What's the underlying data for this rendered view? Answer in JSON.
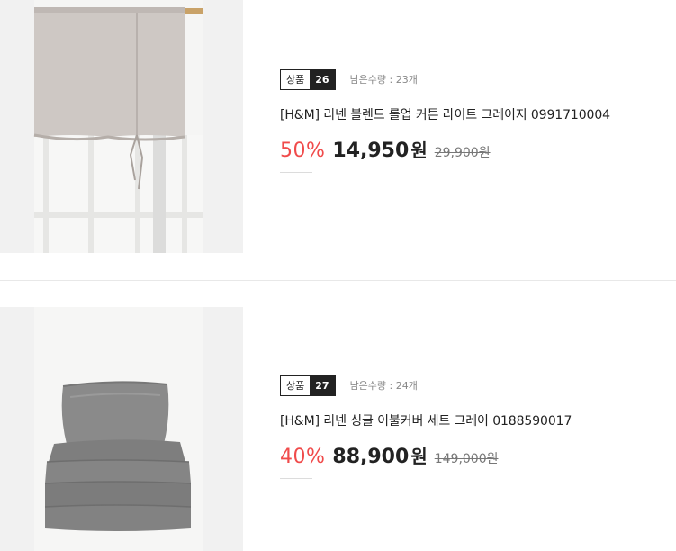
{
  "products": [
    {
      "badge_label": "상품",
      "badge_number": "26",
      "stock_text": "남은수량 : 23개",
      "title": "[H&M] 리넨 블렌드 롤업 커튼 라이트 그레이지 0991710004",
      "discount": "50%",
      "price": "14,950",
      "currency": "원",
      "original_price": "29,900원",
      "image": "curtain-photo"
    },
    {
      "badge_label": "상품",
      "badge_number": "27",
      "stock_text": "남은수량 : 24개",
      "title": "[H&M] 리넨 싱글 이불커버 세트 그레이 0188590017",
      "discount": "40%",
      "price": "88,900",
      "currency": "원",
      "original_price": "149,000원",
      "image": "duvet-photo"
    }
  ],
  "colors": {
    "discount": "#f04b4b",
    "badge_dark": "#222222",
    "muted": "#888888"
  }
}
